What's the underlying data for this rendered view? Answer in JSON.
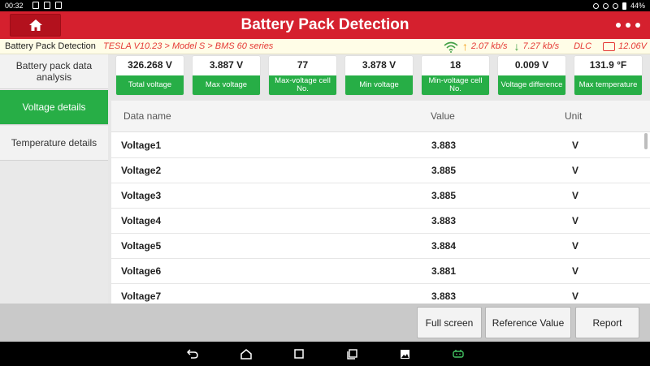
{
  "status_bar": {
    "time": "00:32",
    "battery": "44%"
  },
  "app_bar": {
    "title": "Battery Pack Detection"
  },
  "info_bar": {
    "module": "Battery Pack Detection",
    "path": "TESLA V10.23 > Model S > BMS 60 series",
    "upload_speed": "2.07 kb/s",
    "download_speed": "7.27 kb/s",
    "connection": "DLC",
    "voltage": "12.06V"
  },
  "sidebar": {
    "items": [
      {
        "label": "Battery pack data analysis",
        "active": false
      },
      {
        "label": "Voltage details",
        "active": true
      },
      {
        "label": "Temperature details",
        "active": false
      }
    ]
  },
  "summary": [
    {
      "value": "326.268 V",
      "label": "Total voltage"
    },
    {
      "value": "3.887 V",
      "label": "Max voltage"
    },
    {
      "value": "77",
      "label": "Max-voltage cell No."
    },
    {
      "value": "3.878 V",
      "label": "Min voltage"
    },
    {
      "value": "18",
      "label": "Min-voltage cell No."
    },
    {
      "value": "0.009 V",
      "label": "Voltage difference"
    },
    {
      "value": "131.9 °F",
      "label": "Max temperature"
    }
  ],
  "table": {
    "headers": [
      "Data name",
      "Value",
      "Unit"
    ],
    "rows": [
      {
        "name": "Voltage1",
        "value": "3.883",
        "unit": "V"
      },
      {
        "name": "Voltage2",
        "value": "3.885",
        "unit": "V"
      },
      {
        "name": "Voltage3",
        "value": "3.885",
        "unit": "V"
      },
      {
        "name": "Voltage4",
        "value": "3.883",
        "unit": "V"
      },
      {
        "name": "Voltage5",
        "value": "3.884",
        "unit": "V"
      },
      {
        "name": "Voltage6",
        "value": "3.881",
        "unit": "V"
      },
      {
        "name": "Voltage7",
        "value": "3.883",
        "unit": "V"
      }
    ]
  },
  "actions": {
    "full_screen": "Full screen",
    "reference_value": "Reference Value",
    "report": "Report"
  },
  "colors": {
    "header_red": "#d5202e",
    "accent_green": "#27ae46",
    "path_red": "#e53935"
  }
}
